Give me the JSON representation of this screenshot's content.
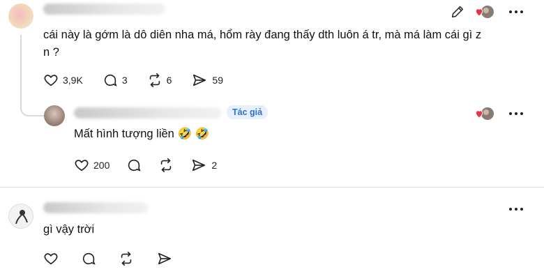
{
  "comment1": {
    "text": "cái này là gớm là dô diên nha má, hổm rày đang thấy dth luôn á tr, mà má làm cái gì z n  ?",
    "likes": "3,9K",
    "replies": "3",
    "reposts": "6",
    "shares": "59"
  },
  "reply1": {
    "badge": "Tác giả",
    "text": "Mất hình tượng liền 🤣 🤣",
    "likes": "200",
    "shares": "2"
  },
  "comment2": {
    "text": "gì vậy trời"
  },
  "colors": {
    "badge_bg": "#e8f0fb",
    "badge_text": "#2b6fd6",
    "heart": "#e8334a"
  },
  "icons": [
    "edit-icon",
    "heart-avatar-icon",
    "more-icon",
    "heart-icon",
    "comment-icon",
    "repost-icon",
    "share-icon"
  ]
}
